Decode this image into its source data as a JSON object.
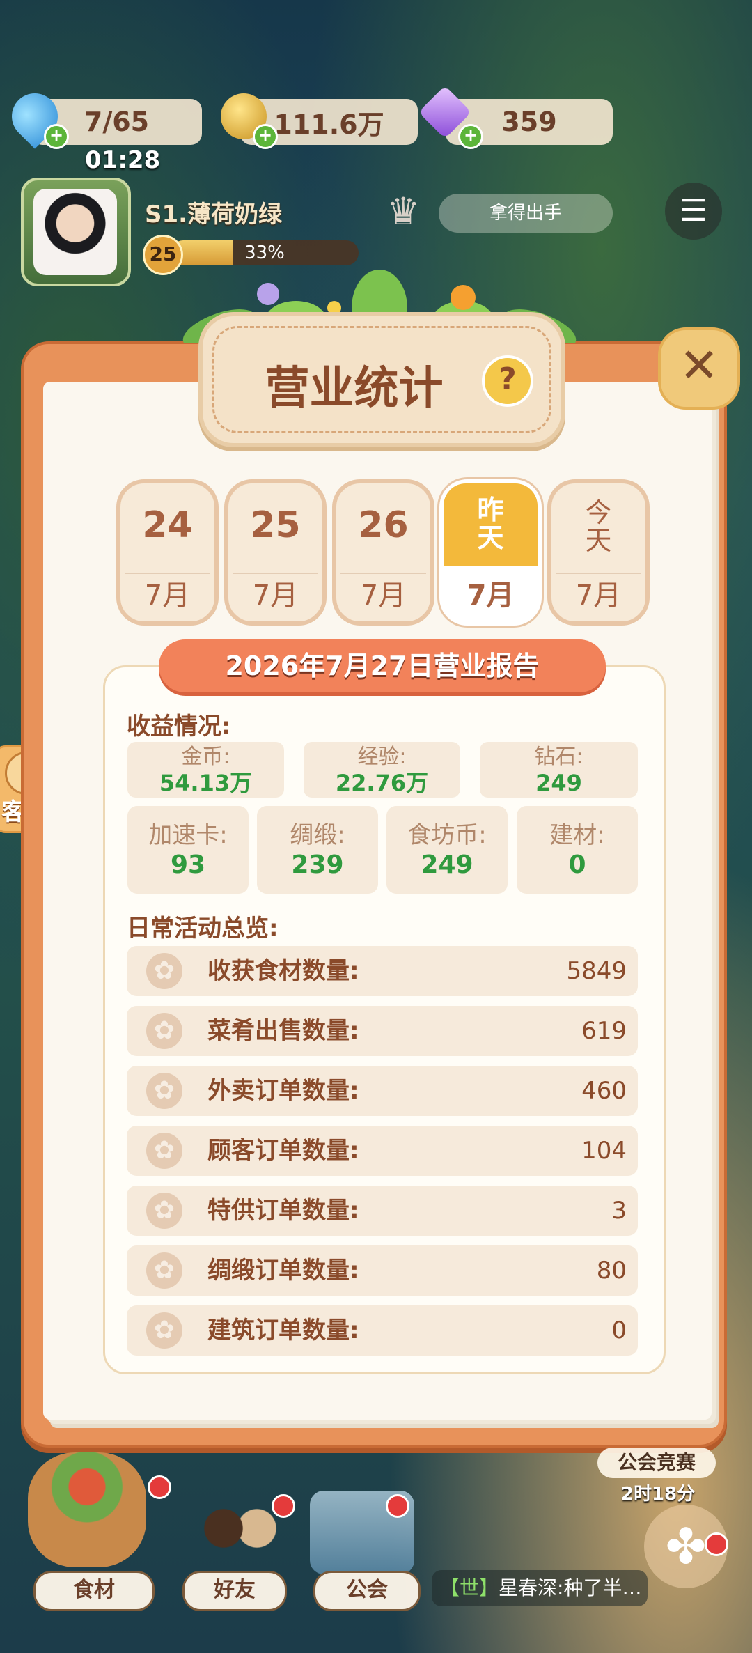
{
  "resources": {
    "water": "7/65",
    "water_timer": "01:28",
    "gold": "111.6万",
    "gems": "359"
  },
  "player": {
    "name": "S1.薄荷奶绿",
    "level": "25",
    "xp_percent": "33%",
    "xp_fraction": 0.33,
    "catch_label": "拿得出手"
  },
  "panel": {
    "title": "营业统计",
    "help_icon": "?",
    "close_icon": "✕"
  },
  "dates": [
    {
      "day": "24",
      "month": "7月"
    },
    {
      "day": "25",
      "month": "7月"
    },
    {
      "day": "26",
      "month": "7月"
    },
    {
      "day1": "昨",
      "day2": "天",
      "month": "7月",
      "selected": true
    },
    {
      "day1": "今",
      "day2": "天",
      "month": "7月"
    }
  ],
  "report": {
    "header": "2026年7月27日营业报告",
    "income_title": "收益情况:",
    "income_top": [
      {
        "label": "金币:",
        "value": "54.13万"
      },
      {
        "label": "经验:",
        "value": "22.76万"
      },
      {
        "label": "钻石:",
        "value": "249"
      }
    ],
    "income_bottom": [
      {
        "label": "加速卡:",
        "value": "93"
      },
      {
        "label": "绸缎:",
        "value": "239"
      },
      {
        "label": "食坊币:",
        "value": "249"
      },
      {
        "label": "建材:",
        "value": "0"
      }
    ],
    "daily_title": "日常活动总览:",
    "daily": [
      {
        "label": "收获食材数量:",
        "value": "5849"
      },
      {
        "label": "菜肴出售数量:",
        "value": "619"
      },
      {
        "label": "外卖订单数量:",
        "value": "460"
      },
      {
        "label": "顾客订单数量:",
        "value": "104"
      },
      {
        "label": "特供订单数量:",
        "value": "3"
      },
      {
        "label": "绸缎订单数量:",
        "value": "80"
      },
      {
        "label": "建筑订单数量:",
        "value": "0"
      }
    ]
  },
  "side": {
    "service": "客服"
  },
  "bottom": {
    "ingredients": "食材",
    "friends": "好友",
    "guild": "公会",
    "chat_world": "【世】",
    "chat_text": "星春深:种了半…",
    "guild_competition": "公会竞赛",
    "guild_timer": "2时18分"
  },
  "colors": {
    "accent": "#f2825a",
    "value_green": "#2f9a3e",
    "label_brown": "#8a4a2a",
    "selected_tab": "#f3b93b"
  }
}
